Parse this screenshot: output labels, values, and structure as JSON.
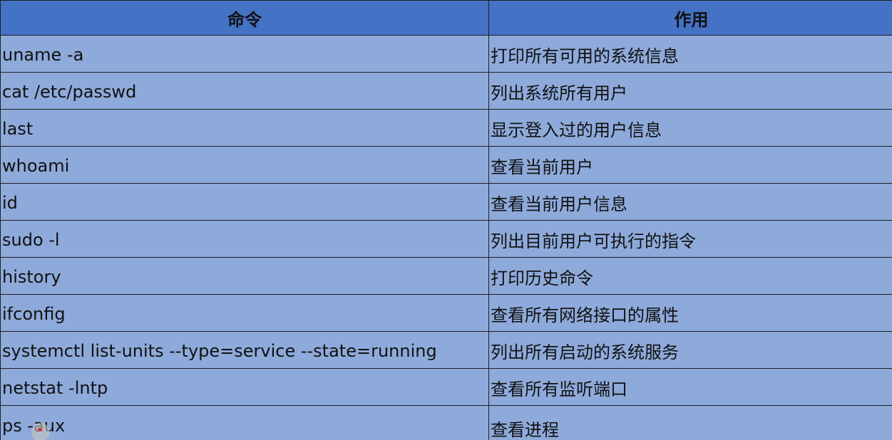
{
  "table": {
    "headers": [
      "命令",
      "作用"
    ],
    "rows": [
      {
        "command": "uname -a",
        "purpose": "打印所有可用的系统信息"
      },
      {
        "command": "cat /etc/passwd",
        "purpose": "列出系统所有用户"
      },
      {
        "command": "last",
        "purpose": "显示登入过的用户信息"
      },
      {
        "command": "whoami",
        "purpose": "查看当前用户"
      },
      {
        "command": "id",
        "purpose": "查看当前用户信息"
      },
      {
        "command": "sudo -l",
        "purpose": "列出目前用户可执行的指令"
      },
      {
        "command": "history",
        "purpose": "打印历史命令"
      },
      {
        "command": "ifconfig",
        "purpose": "查看所有网络接口的属性"
      },
      {
        "command": "systemctl list-units --type=service --state=running",
        "purpose": "列出所有启动的系统服务"
      },
      {
        "command": "netstat -lntp",
        "purpose": "查看所有监听端口"
      },
      {
        "command": "ps -aux",
        "purpose": "查看进程"
      }
    ]
  },
  "colors": {
    "header_bg": "#4472c4",
    "cell_bg": "#8eaadb",
    "border": "#1f1f1f"
  }
}
